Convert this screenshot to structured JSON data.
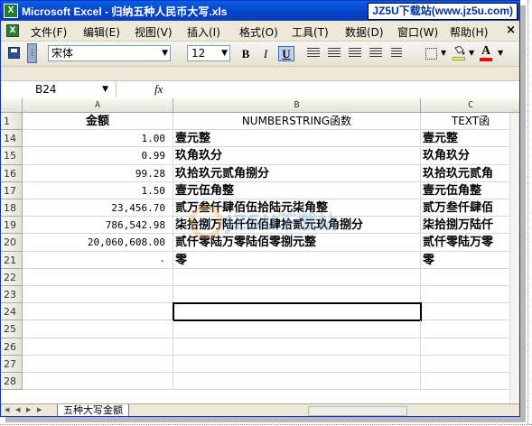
{
  "window": {
    "title": "Microsoft Excel - 归纳五种人民币大写.xls",
    "watermark_badge": "JZ5U下载站(www.jz5u.com)"
  },
  "menu": {
    "items": [
      "文件(F)",
      "编辑(E)",
      "视图(V)",
      "插入(I)",
      "格式(O)",
      "工具(T)",
      "数据(D)",
      "窗口(W)",
      "帮助(H)"
    ],
    "close_glyph": "×"
  },
  "toolbar": {
    "font_name": "宋体",
    "font_size": "12",
    "bold_label": "B",
    "italic_label": "I",
    "underline_label": "U",
    "font_color_label": "A",
    "fill_color": "#FFFF00",
    "font_color": "#FF0000"
  },
  "formula_bar": {
    "name_box": "B24",
    "fx_label": "fx",
    "formula": ""
  },
  "grid": {
    "columns": [
      "A",
      "B",
      "C"
    ],
    "header_row": {
      "row": "1",
      "a": "金额",
      "b": "NUMBERSTRING函数",
      "c": "TEXT函"
    },
    "rows": [
      {
        "row": "14",
        "a": "1.00",
        "b": "壹元整",
        "c": "壹元整"
      },
      {
        "row": "15",
        "a": "0.99",
        "b": "玖角玖分",
        "c": "玖角玖分"
      },
      {
        "row": "16",
        "a": "99.28",
        "b": "玖拾玖元贰角捌分",
        "c": "玖拾玖元贰角"
      },
      {
        "row": "17",
        "a": "1.50",
        "b": "壹元伍角整",
        "c": "壹元伍角整"
      },
      {
        "row": "18",
        "a": "23,456.70",
        "b": "贰万叁仟肆佰伍拾陆元柒角整",
        "c": "贰万叁仟肆佰"
      },
      {
        "row": "19",
        "a": "786,542.98",
        "b": "柒拾捌万陆仟伍佰肆拾贰元玖角捌分",
        "c": "柒拾捌万陆仟"
      },
      {
        "row": "20",
        "a": "20,060,608.00",
        "b": "贰仟零陆万零陆佰零捌元整",
        "c": "贰仟零陆万零"
      },
      {
        "row": "21",
        "a": "-",
        "b": "零",
        "c": "零"
      },
      {
        "row": "22",
        "a": "",
        "b": "",
        "c": ""
      },
      {
        "row": "23",
        "a": "",
        "b": "",
        "c": ""
      },
      {
        "row": "24",
        "a": "",
        "b": "",
        "c": ""
      },
      {
        "row": "25",
        "a": "",
        "b": "",
        "c": ""
      },
      {
        "row": "26",
        "a": "",
        "b": "",
        "c": ""
      },
      {
        "row": "27",
        "a": "",
        "b": "",
        "c": ""
      },
      {
        "row": "28",
        "a": "",
        "b": "",
        "c": ""
      }
    ]
  },
  "sheet": {
    "tab_label": "五种大写金额"
  },
  "overlay_watermark": {
    "text": "JZ5U下载站"
  }
}
